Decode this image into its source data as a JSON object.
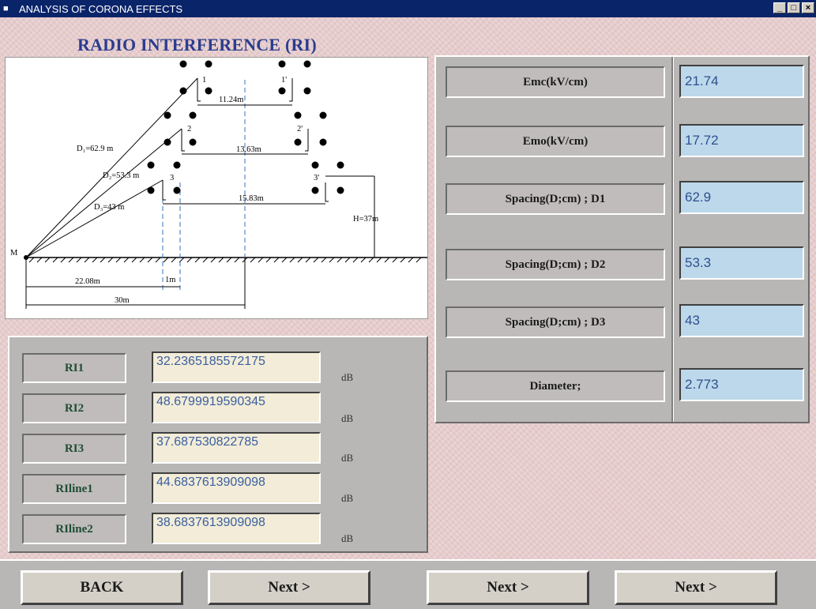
{
  "window": {
    "title": "ANALYSIS OF CORONA EFFECTS",
    "minimize": "_",
    "maximize": "□",
    "close": "×"
  },
  "heading": "RADIO INTERFERENCE (RI)",
  "diagram": {
    "phase_labels": [
      "1",
      "1'",
      "2",
      "2'",
      "3",
      "3'"
    ],
    "spacing_1": "11.24m",
    "spacing_2": "13.63m",
    "spacing_3": "15.83m",
    "d1": "D₁=62.9 m",
    "d2": "D₂=53.3 m",
    "d3": "D₃=43 m",
    "height": "H=37m",
    "point": "M",
    "dist_1": "22.08m",
    "dist_2": "1m",
    "dist_3": "30m"
  },
  "params": [
    {
      "label": "Emc(kV/cm)",
      "value": "21.74"
    },
    {
      "label": "Emo(kV/cm)",
      "value": "17.72"
    },
    {
      "label": "Spacing(D;cm) ; D1",
      "value": "62.9"
    },
    {
      "label": "Spacing(D;cm) ; D2",
      "value": "53.3"
    },
    {
      "label": "Spacing(D;cm) ; D3",
      "value": "43"
    },
    {
      "label": "Diameter;",
      "value": "2.773"
    }
  ],
  "results": [
    {
      "label": "RI1",
      "value": "32.2365185572175",
      "unit": "dB"
    },
    {
      "label": "RI2",
      "value": "48.6799919590345",
      "unit": "dB"
    },
    {
      "label": "RI3",
      "value": "37.687530822785",
      "unit": "dB"
    },
    {
      "label": "RIline1",
      "value": "44.6837613909098",
      "unit": "dB"
    },
    {
      "label": "RIline2",
      "value": "38.6837613909098",
      "unit": "dB"
    }
  ],
  "buttons": {
    "back": "BACK",
    "next1": "Next >",
    "next2": "Next >",
    "next3": "Next >"
  }
}
